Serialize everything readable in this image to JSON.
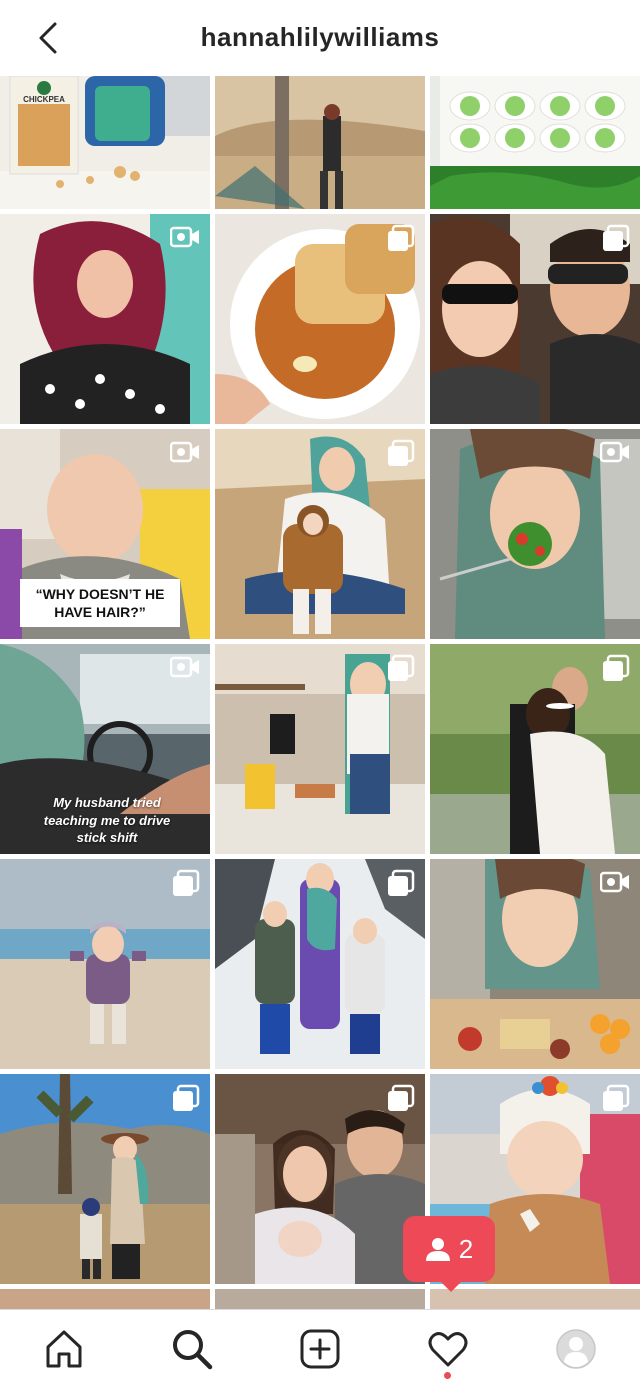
{
  "header": {
    "title": "hannahlilywilliams"
  },
  "tiles": [
    {
      "name": "post-chickpea-pasta",
      "badge": "none",
      "bg": "#e9e6df",
      "box_text": "CHICKPEA",
      "type": "photo"
    },
    {
      "name": "post-desert-tree",
      "badge": "none",
      "bg": "#c9a77c",
      "type": "photo"
    },
    {
      "name": "post-green-deviled-eggs",
      "badge": "none",
      "bg": "#8fbf5e",
      "type": "photo"
    },
    {
      "name": "post-red-hair-flip",
      "badge": "video",
      "bg": "#5fb8b1",
      "type": "video"
    },
    {
      "name": "post-bread-bowl-curry",
      "badge": "carousel",
      "bg": "#e5dcd0",
      "type": "carousel"
    },
    {
      "name": "post-car-selfie",
      "badge": "carousel",
      "bg": "#6e5444",
      "type": "carousel"
    },
    {
      "name": "post-baby-no-hair",
      "badge": "video",
      "bg": "#b9a894",
      "type": "video",
      "caption": "“WHY DOESN’T HE HAVE HAIR?”"
    },
    {
      "name": "post-mom-and-baby-desert",
      "badge": "carousel",
      "bg": "#c9b08a",
      "type": "carousel"
    },
    {
      "name": "post-eating-salad",
      "badge": "video",
      "bg": "#8a8c86",
      "type": "video"
    },
    {
      "name": "post-driving-stick-shift",
      "badge": "video",
      "bg": "#6b7e83",
      "type": "video",
      "caption": "My husband tried teaching me to drive stick shift"
    },
    {
      "name": "post-kitchen-cooking",
      "badge": "carousel",
      "bg": "#c7b8a3",
      "type": "carousel"
    },
    {
      "name": "post-wedding-hug",
      "badge": "carousel",
      "bg": "#6f8a4e",
      "type": "carousel"
    },
    {
      "name": "post-toddler-beach",
      "badge": "carousel",
      "bg": "#c8c3bc",
      "type": "carousel"
    },
    {
      "name": "post-snow-family",
      "badge": "carousel",
      "bg": "#dfe5ea",
      "type": "carousel"
    },
    {
      "name": "post-charcuterie-board",
      "badge": "video",
      "bg": "#a88b6a",
      "type": "video"
    },
    {
      "name": "post-joshua-tree-family",
      "badge": "carousel",
      "bg": "#4f8fc8",
      "type": "carousel"
    },
    {
      "name": "post-hospital-newborn",
      "badge": "carousel",
      "bg": "#8d7766",
      "type": "carousel"
    },
    {
      "name": "post-baby-beanie",
      "badge": "carousel",
      "bg": "#d9d4cc",
      "type": "carousel"
    }
  ],
  "notification": {
    "count": "2",
    "icon": "person-icon"
  },
  "tabs": [
    {
      "name": "home",
      "icon": "home-icon"
    },
    {
      "name": "search",
      "icon": "search-icon"
    },
    {
      "name": "new-post",
      "icon": "plus-square-icon"
    },
    {
      "name": "activity",
      "icon": "heart-icon"
    },
    {
      "name": "profile",
      "icon": "avatar-icon"
    }
  ],
  "colors": {
    "accent_red": "#ed4956",
    "text": "#262626",
    "border": "#dbdbdb"
  }
}
